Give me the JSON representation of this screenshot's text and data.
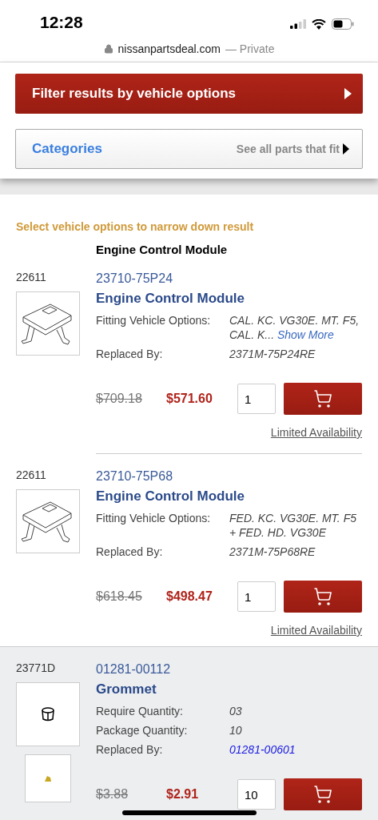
{
  "status_bar": {
    "time": "12:28"
  },
  "address_bar": {
    "domain": "nissanpartsdeal.com",
    "mode": "— Private"
  },
  "filter_button": {
    "label": "Filter results by vehicle options"
  },
  "categories": {
    "label": "Categories",
    "link": "See all parts that fit"
  },
  "notice": "Select vehicle options to narrow down result",
  "group_title": "Engine Control Module",
  "parts": [
    {
      "ref": "22611",
      "number": "23710-75P24",
      "name": "Engine Control Module",
      "highlighted": false,
      "kind": "module",
      "extra_thumbnail": false,
      "details": [
        {
          "label": "Fitting Vehicle Options:",
          "value": "CAL. KC. VG30E. MT. F5, CAL. K...",
          "more": "Show More",
          "kind": "text"
        },
        {
          "label": "Replaced By:",
          "value": "2371M-75P24RE",
          "kind": "text"
        }
      ],
      "list_price": "$709.18",
      "price": "$571.60",
      "quantity": "1",
      "availability": "Limited Availability"
    },
    {
      "ref": "22611",
      "number": "23710-75P68",
      "name": "Engine Control Module",
      "highlighted": false,
      "kind": "module",
      "extra_thumbnail": false,
      "details": [
        {
          "label": "Fitting Vehicle Options:",
          "value": "FED. KC. VG30E. MT. F5 + FED. HD. VG30E",
          "kind": "text"
        },
        {
          "label": "Replaced By:",
          "value": "2371M-75P68RE",
          "kind": "text"
        }
      ],
      "list_price": "$618.45",
      "price": "$498.47",
      "quantity": "1",
      "availability": "Limited Availability"
    },
    {
      "ref": "23771D",
      "number": "01281-00112",
      "name": "Grommet",
      "highlighted": true,
      "kind": "grommet",
      "extra_thumbnail": true,
      "details": [
        {
          "label": "Require Quantity:",
          "value": "03",
          "kind": "text"
        },
        {
          "label": "Package Quantity:",
          "value": "10",
          "kind": "text"
        },
        {
          "label": "Replaced By:",
          "value": "01281-00601",
          "kind": "link"
        }
      ],
      "list_price": "$3.88",
      "price": "$2.91",
      "quantity": "10"
    }
  ]
}
